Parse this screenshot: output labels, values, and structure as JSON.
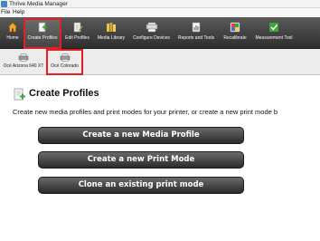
{
  "window": {
    "title": "Thrive Media Manager"
  },
  "menu": {
    "file": "File",
    "help": "Help"
  },
  "toolbar": {
    "items": [
      {
        "label": "Home",
        "icon": "home-icon"
      },
      {
        "label": "Create Profiles",
        "icon": "create-profiles-icon",
        "selected": true
      },
      {
        "label": "Edit Profiles",
        "icon": "edit-profiles-icon"
      },
      {
        "label": "Media Library",
        "icon": "media-library-icon"
      },
      {
        "label": "Configure Devices",
        "icon": "configure-devices-icon"
      },
      {
        "label": "Reports and Tools",
        "icon": "reports-icon"
      },
      {
        "label": "Recalibrate",
        "icon": "recalibrate-icon"
      },
      {
        "label": "Measurement Tool",
        "icon": "measurement-tool-icon"
      }
    ]
  },
  "printers": {
    "items": [
      {
        "label": "Océ Arizona 640 XT",
        "icon": "printer-icon"
      },
      {
        "label": "Océ Colorado",
        "icon": "printer-icon",
        "selected": true
      }
    ]
  },
  "page": {
    "title": "Create Profiles",
    "description": "Create new media profiles and print modes for your printer, or create a new print mode b"
  },
  "actions": {
    "new_media_profile": "Create a new Media Profile",
    "new_print_mode": "Create a new Print Mode",
    "clone_print_mode": "Clone an existing print mode"
  },
  "colors": {
    "highlight": "#e31e24",
    "ribbon": "#3a3a3a",
    "button": "#2a2a2a"
  }
}
